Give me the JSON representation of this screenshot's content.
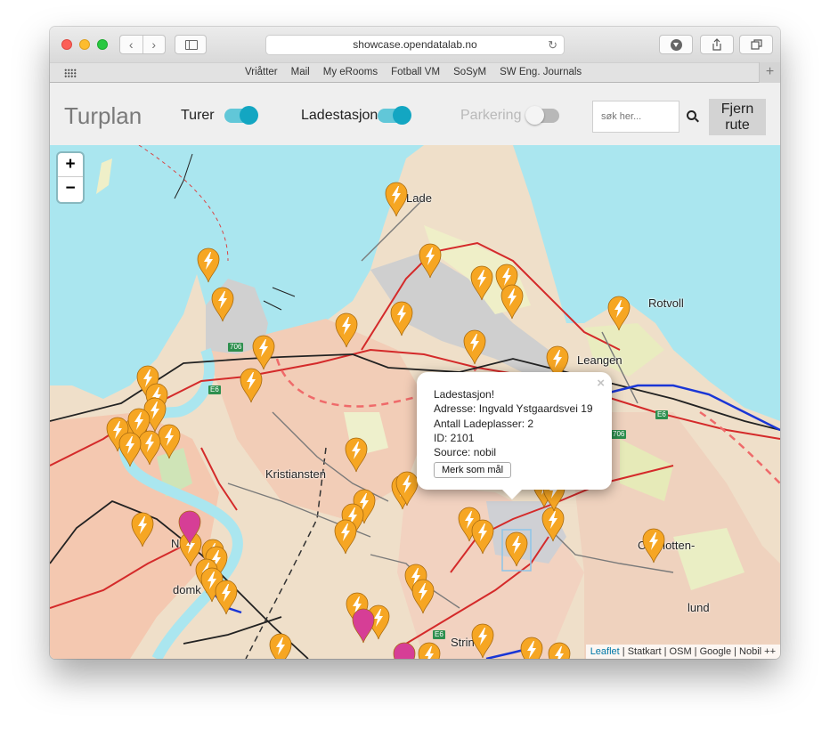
{
  "browser": {
    "url": "showcase.opendatalab.no",
    "bookmarks": [
      "Vriåtter",
      "Mail",
      "My eRooms",
      "Fotball VM",
      "SoSyM",
      "SW Eng. Journals"
    ]
  },
  "app": {
    "title": "Turplan",
    "toggles": [
      {
        "label": "Turer",
        "state": "on"
      },
      {
        "label": "Ladestasjoner",
        "state": "on"
      },
      {
        "label": "Parkering",
        "state": "off"
      }
    ],
    "search_placeholder": "søk her...",
    "remove_route_line1": "Fjern",
    "remove_route_line2": "rute"
  },
  "map": {
    "zoom_in": "+",
    "zoom_out": "−",
    "places": {
      "lade": "Lade",
      "rotvoll": "Rotvoll",
      "leangen": "Leangen",
      "kristiansten": "Kristiansten",
      "charlotten": "Charlotten-",
      "lund": "lund",
      "domk": "domk",
      "strinda": "Strinda",
      "nidaros_prefix": "Ni"
    },
    "road_shields": [
      "706",
      "E6",
      "E6",
      "706",
      "E6"
    ],
    "marker_color": "#f6a623",
    "selected_marker_color": "#d63e96"
  },
  "popup": {
    "title": "Ladestasjon!",
    "address": "Adresse: Ingvald Ystgaardsvei 19",
    "slots": "Antall Ladeplasser: 2",
    "id": "ID: 2101",
    "source": "Source: nobil",
    "button": "Merk som mål",
    "close": "×"
  },
  "attribution": {
    "leaflet": "Leaflet",
    "rest": " | Statkart | OSM | Google | Nobil ++"
  }
}
